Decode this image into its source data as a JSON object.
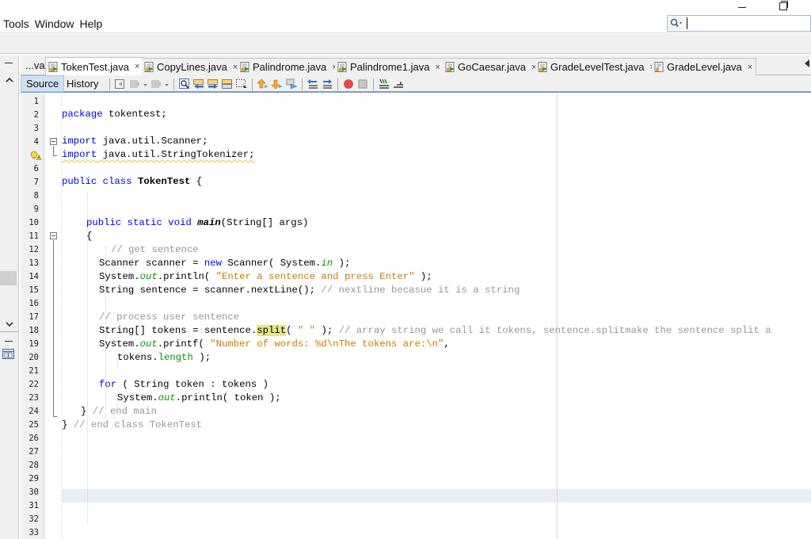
{
  "menubar": {
    "items": [
      "Tools",
      "Window",
      "Help"
    ]
  },
  "search": {
    "value": "",
    "icon": "search-icon"
  },
  "editor_tabs": {
    "overflow_label": "...va",
    "tabs": [
      {
        "label": "TokenTest.java",
        "active": true
      },
      {
        "label": "CopyLines.java",
        "active": false
      },
      {
        "label": "Palindrome.java",
        "active": false
      },
      {
        "label": "Palindrome1.java",
        "active": false
      },
      {
        "label": "GoCaesar.java",
        "active": false
      },
      {
        "label": "GradeLevelTest.java",
        "active": false
      },
      {
        "label": "GradeLevel.java",
        "active": false
      }
    ],
    "close_glyph": "×"
  },
  "view_switch": {
    "source": "Source",
    "history": "History",
    "active": "Source"
  },
  "editor": {
    "line_numbers": [
      "1",
      "2",
      "3",
      "4",
      "5",
      "6",
      "7",
      "8",
      "9",
      "10",
      "11",
      "12",
      "13",
      "14",
      "15",
      "16",
      "17",
      "18",
      "19",
      "20",
      "21",
      "22",
      "23",
      "24",
      "25",
      "26",
      "27",
      "28",
      "29",
      "30",
      "31",
      "32",
      "33"
    ],
    "current_line": 30,
    "warning_line": 5,
    "lines": [
      {
        "n": 1,
        "tokens": []
      },
      {
        "n": 2,
        "tokens": [
          [
            "kw",
            "package"
          ],
          [
            "",
            "tokentest;"
          ]
        ],
        "raw": "package tokentest;"
      },
      {
        "n": 3,
        "tokens": []
      },
      {
        "n": 4,
        "raw": "import java.util.Scanner;"
      },
      {
        "n": 5,
        "raw": "import java.util.StringTokenizer;"
      },
      {
        "n": 6,
        "tokens": []
      },
      {
        "n": 7,
        "raw": "public class TokenTest {"
      },
      {
        "n": 10,
        "raw": "    public static void main(String[] args)"
      },
      {
        "n": 11,
        "raw": "    {"
      },
      {
        "n": 12,
        "raw": "        // get sentence"
      },
      {
        "n": 13,
        "raw": "      Scanner scanner = new Scanner( System.in );"
      },
      {
        "n": 14,
        "raw": "      System.out.println( \"Enter a sentence and press Enter\" );"
      },
      {
        "n": 15,
        "raw": "      String sentence = scanner.nextLine(); // nextline becasue it is a string"
      },
      {
        "n": 17,
        "raw": "      // process user sentence"
      },
      {
        "n": 18,
        "raw": "      String[] tokens = sentence.split( \" \" ); // array string we call it tokens, sentence.splitmake the sentence split a"
      },
      {
        "n": 19,
        "raw": "      System.out.printf( \"Number of words: %d\\nThe tokens are:\\n\","
      },
      {
        "n": 20,
        "raw": "         tokens.length );"
      },
      {
        "n": 22,
        "raw": "      for ( String token : tokens )"
      },
      {
        "n": 23,
        "raw": "         System.out.println( token );"
      },
      {
        "n": 24,
        "raw": "   } // end main"
      },
      {
        "n": 25,
        "raw": "} // end class TokenTest"
      }
    ],
    "text": {
      "l2_kw": "package",
      "l2_rest": " tokentest;",
      "l4_kw": "import",
      "l4_rest": " java.util.Scanner;",
      "l5_kw": "import",
      "l5_rest": " java.util.StringTokenizer;",
      "l7_kw": "public class",
      "l7_name": "TokenTest",
      "l7_rest": " {",
      "l10_kw": "public static void",
      "l10_name": "main",
      "l10_rest": "(String[] args)",
      "l11": "{",
      "l12_cmt": "// get sentence",
      "l13_a": "Scanner scanner = ",
      "l13_kw": "new",
      "l13_b": " Scanner( System.",
      "l13_fld": "in",
      "l13_c": " );",
      "l14_a": "System.",
      "l14_fld": "out",
      "l14_b": ".println( ",
      "l14_str": "\"Enter a sentence and press Enter\"",
      "l14_c": " );",
      "l15_a": "String sentence = scanner.nextLine(); ",
      "l15_cmt": "// nextline becasue it is a string",
      "l17_cmt": "// process user sentence",
      "l18_a": "String[] tokens = sentence.",
      "l18_hl": "split",
      "l18_b": "( ",
      "l18_str": "\" \"",
      "l18_c": " ); ",
      "l18_cmt": "// array string we call it tokens, sentence.splitmake the sentence split a",
      "l19_a": "System.",
      "l19_fld": "out",
      "l19_b": ".printf( ",
      "l19_str": "\"Number of words: %d\\nThe tokens are:\\n\"",
      "l19_c": ",",
      "l20_a": "tokens.",
      "l20_fld": "length",
      "l20_b": " );",
      "l22_kw": "for",
      "l22_rest": " ( String token : tokens )",
      "l23_a": "System.",
      "l23_fld": "out",
      "l23_b": ".println( token );",
      "l24_a": "} ",
      "l24_cmt": "// end main",
      "l25_a": "} ",
      "l25_cmt": "// end class TokenTest"
    }
  },
  "colors": {
    "keyword": "#0000e6",
    "string": "#ce7b00",
    "comment": "#969696",
    "field": "#009900",
    "current_line_bg": "#e8eef7",
    "highlight": "#e6e68a",
    "active_view_tab": "#cfe1f4"
  }
}
